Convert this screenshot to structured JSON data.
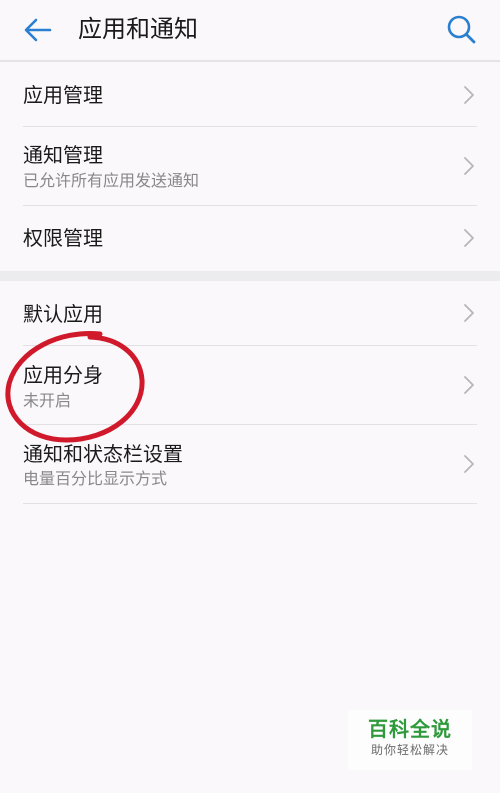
{
  "header": {
    "title": "应用和通知",
    "back_icon": "back-arrow-icon",
    "search_icon": "search-icon",
    "accent_color": "#2b7fd1"
  },
  "items": [
    {
      "label": "应用管理",
      "subtitle": ""
    },
    {
      "label": "通知管理",
      "subtitle": "已允许所有应用发送通知"
    },
    {
      "label": "权限管理",
      "subtitle": ""
    },
    {
      "label": "默认应用",
      "subtitle": ""
    },
    {
      "label": "应用分身",
      "subtitle": "未开启"
    },
    {
      "label": "通知和状态栏设置",
      "subtitle": "电量百分比显示方式"
    }
  ],
  "annotation": {
    "color": "#d0192b"
  },
  "watermark": {
    "main": "百科全说",
    "sub": "助你轻松解决"
  }
}
